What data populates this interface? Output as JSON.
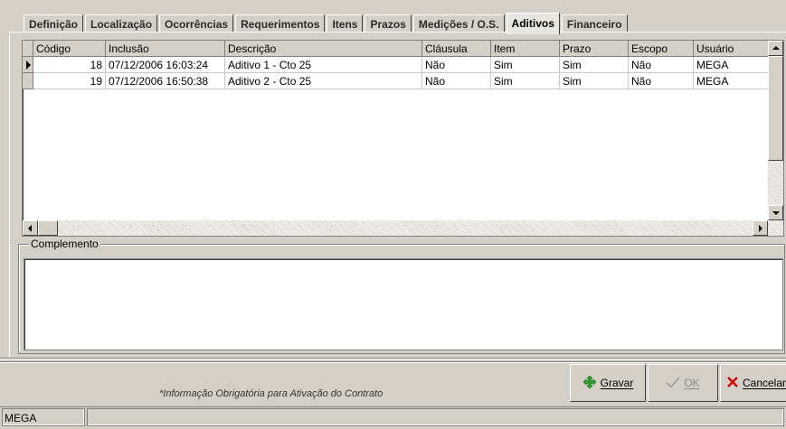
{
  "tabs": [
    {
      "label": "Definição",
      "active": false
    },
    {
      "label": "Localização",
      "active": false
    },
    {
      "label": "Ocorrências",
      "active": false
    },
    {
      "label": "Requerimentos",
      "active": false
    },
    {
      "label": "Itens",
      "active": false
    },
    {
      "label": "Prazos",
      "active": false
    },
    {
      "label": "Medições / O.S.",
      "active": false
    },
    {
      "label": "Aditivos",
      "active": true
    },
    {
      "label": "Financeiro",
      "active": false
    }
  ],
  "grid": {
    "columns": [
      "Código",
      "Inclusão",
      "Descrição",
      "Cláusula",
      "Item",
      "Prazo",
      "Escopo",
      "Usuário"
    ],
    "rows": [
      {
        "codigo": "18",
        "inclusao": "07/12/2006 16:03:24",
        "descricao": "Aditivo 1 - Cto 25",
        "clausula": "Não",
        "item": "Sim",
        "prazo": "Sim",
        "escopo": "Não",
        "usuario": "MEGA"
      },
      {
        "codigo": "19",
        "inclusao": "07/12/2006 16:50:38",
        "descricao": "Aditivo 2 - Cto 25",
        "clausula": "Não",
        "item": "Sim",
        "prazo": "Sim",
        "escopo": "Não",
        "usuario": "MEGA"
      }
    ]
  },
  "complemento": {
    "label": "Complemento",
    "value": ""
  },
  "footer_note": "*Informação Obrigatória para Ativação do Contrato",
  "buttons": {
    "gravar": "Gravar",
    "ok": "OK",
    "cancelar": "Cancelar"
  },
  "status": {
    "user": "MEGA"
  },
  "icons": {
    "gravar": "green-diamond-arrows-icon",
    "ok": "check-icon",
    "cancelar": "red-x-icon"
  },
  "colors": {
    "background": "#d4d0c8",
    "gravar_icon": "#2e9e2e",
    "cancel_icon": "#d00000"
  }
}
